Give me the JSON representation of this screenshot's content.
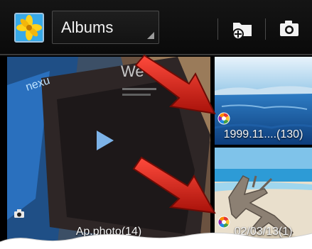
{
  "action_bar": {
    "logo_icon": "gallery-app-icon",
    "album_selector_label": "Albums",
    "buttons": [
      {
        "name": "new-folder-button",
        "icon": "folder-add-icon"
      },
      {
        "name": "camera-button",
        "icon": "camera-icon"
      }
    ]
  },
  "albums": [
    {
      "name": "album-ap-photo",
      "caption": "Ap.photo(14)",
      "badge_icon": "camera-icon",
      "thumb_text": "nexu"
    },
    {
      "name": "album-1999-11",
      "caption": "1999.11....(130)",
      "badge_icon": "picasa-sync-icon"
    },
    {
      "name": "album-02-03-13",
      "caption": "02/03/13(1)",
      "badge_icon": "picasa-sync-icon"
    }
  ],
  "annotations": {
    "arrows": 2,
    "arrow_color": "#d41f14"
  },
  "colors": {
    "background": "#000000",
    "caption_text": "#f5f5f5",
    "spinner_border": "#4a4a4a"
  }
}
